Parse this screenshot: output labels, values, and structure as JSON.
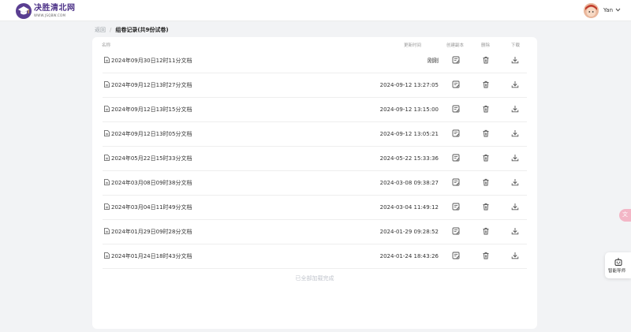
{
  "header": {
    "brand_name": "决胜清北网",
    "brand_url": "WWW.JSQBW.COM",
    "username": "Yan"
  },
  "breadcrumb": {
    "back": "返回",
    "separator": "/",
    "current": "组卷记录(共9份试卷)"
  },
  "table": {
    "columns": {
      "name": "名称",
      "updated": "更新时间",
      "create_copy": "创建副本",
      "delete": "删除",
      "download": "下载"
    },
    "rows": [
      {
        "name": "2024年09月30日12时11分文档",
        "time": "刚刚"
      },
      {
        "name": "2024年09月12日13时27分文档",
        "time": "2024-09-12 13:27:05"
      },
      {
        "name": "2024年09月12日13时15分文档",
        "time": "2024-09-12 13:15:00"
      },
      {
        "name": "2024年09月12日13时05分文档",
        "time": "2024-09-12 13:05:21"
      },
      {
        "name": "2024年05月22日15时33分文档",
        "time": "2024-05-22 15:33:36"
      },
      {
        "name": "2024年03月08日09时38分文档",
        "time": "2024-03-08 09:38:27"
      },
      {
        "name": "2024年03月04日11时49分文档",
        "time": "2024-03-04 11:49:12"
      },
      {
        "name": "2024年01月29日09时28分文档",
        "time": "2024-01-29 09:28:52"
      },
      {
        "name": "2024年01月24日18时43分文档",
        "time": "2024-01-24 18:43:26"
      }
    ],
    "footer": "已全部加载完成"
  },
  "side": {
    "guide_label": "智能导师"
  },
  "colors": {
    "brand": "#4a2f86",
    "panel": "#ffffff",
    "background": "#f2f3f5"
  }
}
